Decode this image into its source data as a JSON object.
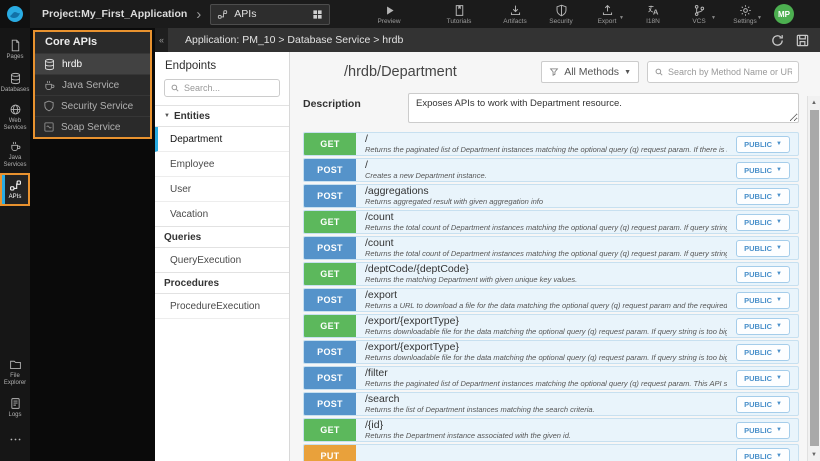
{
  "topbar": {
    "project_label": "Project:My_First_Application",
    "selector_label": "APIs",
    "center": [
      {
        "id": "preview",
        "label": "Preview",
        "icon": "preview-play-icon"
      },
      {
        "id": "tutorials",
        "label": "Tutorials",
        "icon": "tutorials-icon"
      }
    ],
    "right": [
      {
        "id": "artifacts",
        "label": "Artifacts",
        "icon": "artifacts-download-icon",
        "has_caret": false
      },
      {
        "id": "security",
        "label": "Security",
        "icon": "security-shield-icon",
        "has_caret": false
      },
      {
        "id": "export",
        "label": "Export",
        "icon": "export-upload-icon",
        "has_caret": true
      },
      {
        "id": "i18n",
        "label": "I18N",
        "icon": "i18n-translate-icon",
        "has_caret": false
      },
      {
        "id": "vcs",
        "label": "VCS",
        "icon": "vcs-branch-icon",
        "has_caret": true
      },
      {
        "id": "settings",
        "label": "Settings",
        "icon": "settings-gear-icon",
        "has_caret": true
      }
    ],
    "avatar": "MP"
  },
  "sidebar": {
    "top_items": [
      {
        "id": "pages",
        "label": "Pages",
        "icon": "pages-icon",
        "active": false
      },
      {
        "id": "databases",
        "label": "Databases",
        "icon": "database-icon",
        "active": false
      },
      {
        "id": "web-services",
        "label": "Web Services",
        "icon": "globe-icon",
        "active": false
      },
      {
        "id": "java-services",
        "label": "Java Services",
        "icon": "coffee-icon",
        "active": false
      },
      {
        "id": "apis",
        "label": "APIs",
        "icon": "api-icon",
        "active": true
      }
    ],
    "bottom_items": [
      {
        "id": "file-explorer",
        "label": "File Explorer",
        "icon": "folder-icon",
        "active": false
      },
      {
        "id": "logs",
        "label": "Logs",
        "icon": "logs-icon",
        "active": false
      },
      {
        "id": "more",
        "label": "",
        "icon": "more-icon",
        "active": false
      }
    ]
  },
  "core_apis": {
    "title": "Core APIs",
    "items": [
      {
        "id": "hrdb",
        "label": "hrdb",
        "icon": "database-icon",
        "active": true
      },
      {
        "id": "java-service",
        "label": "Java Service",
        "icon": "coffee-icon",
        "active": false
      },
      {
        "id": "security-service",
        "label": "Security Service",
        "icon": "shield-icon",
        "active": false
      },
      {
        "id": "soap-service",
        "label": "Soap Service",
        "icon": "soap-icon",
        "active": false
      }
    ]
  },
  "breadcrumb": "Application: PM_10 > Database Service > hrdb",
  "endpoints": {
    "title": "Endpoints",
    "search_placeholder": "Search...",
    "sections": [
      {
        "id": "entities",
        "label": "Entities",
        "collapsible": true,
        "active_item": "Department",
        "items": [
          "Department",
          "Employee",
          "User",
          "Vacation"
        ]
      },
      {
        "id": "queries",
        "label": "Queries",
        "collapsible": false,
        "active_item": "",
        "items": [
          "QueryExecution"
        ]
      },
      {
        "id": "procedures",
        "label": "Procedures",
        "collapsible": false,
        "active_item": "",
        "items": [
          "ProcedureExecution"
        ]
      }
    ]
  },
  "main": {
    "title": "/hrdb/Department",
    "methods_filter": "All Methods",
    "search_placeholder": "Search by Method Name or URL...",
    "description_label": "Description",
    "description_value": "Exposes APIs to work with Department resource.",
    "access_label": "PUBLIC",
    "rows": [
      {
        "method": "GET",
        "path": "/",
        "desc": "Returns the paginated list of Department instances matching the optional query (q) request param. If there is no query pro..."
      },
      {
        "method": "POST",
        "path": "/",
        "desc": "Creates a new Department instance."
      },
      {
        "method": "POST",
        "path": "/aggregations",
        "desc": "Returns aggregated result with given aggregation info"
      },
      {
        "method": "GET",
        "path": "/count",
        "desc": "Returns the total count of Department instances matching the optional query (q) request param. If query string is too big t..."
      },
      {
        "method": "POST",
        "path": "/count",
        "desc": "Returns the total count of Department instances matching the optional query (q) request param. If query string is too big t..."
      },
      {
        "method": "GET",
        "path": "/deptCode/{deptCode}",
        "desc": "Returns the matching Department with given unique key values."
      },
      {
        "method": "POST",
        "path": "/export",
        "desc": "Returns a URL to download a file for the data matching the optional query (q) request param and the required fields provid..."
      },
      {
        "method": "GET",
        "path": "/export/{exportType}",
        "desc": "Returns downloadable file for the data matching the optional query (q) request param. If query string is too big to fit in GET..."
      },
      {
        "method": "POST",
        "path": "/export/{exportType}",
        "desc": "Returns downloadable file for the data matching the optional query (q) request param. If query string is too big to fit in GET..."
      },
      {
        "method": "POST",
        "path": "/filter",
        "desc": "Returns the paginated list of Department instances matching the optional query (q) request param. This API should be use..."
      },
      {
        "method": "POST",
        "path": "/search",
        "desc": "Returns the list of Department instances matching the search criteria."
      },
      {
        "method": "GET",
        "path": "/{id}",
        "desc": "Returns the Department instance associated with the given id."
      },
      {
        "method": "PUT",
        "path": "",
        "desc": ""
      }
    ]
  },
  "colors": {
    "accent_orange": "#e8922f",
    "accent_blue": "#29abe2",
    "avatar_green": "#4caf50",
    "public_text": "#4a90ca",
    "method": {
      "GET": "#5cb85c",
      "POST": "#5593ca",
      "PUT": "#e9a13b"
    }
  }
}
